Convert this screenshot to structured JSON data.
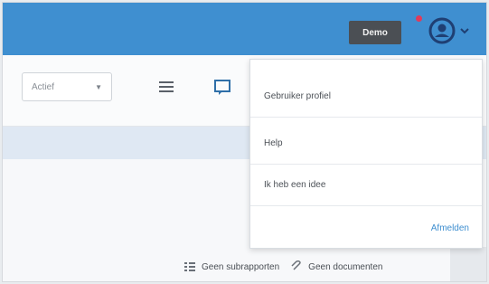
{
  "header": {
    "demo_badge": "Demo",
    "user_icon": "user-circle-icon",
    "chevron_icon": "chevron-down-icon",
    "accent_color": "#3f8fd0",
    "notification_color": "#e23a5a"
  },
  "toolbar": {
    "select_value": "Actief",
    "list_icon": "list-view-icon",
    "chat_icon": "chat-icon"
  },
  "user_menu": {
    "items": [
      {
        "label": "Gebruiker profiel"
      },
      {
        "label": "Help"
      },
      {
        "label": "Ik heb een idee"
      }
    ],
    "logout_label": "Afmelden"
  },
  "actions": {
    "subreports_label": "Geen subrapporten",
    "documents_label": "Geen documenten"
  }
}
